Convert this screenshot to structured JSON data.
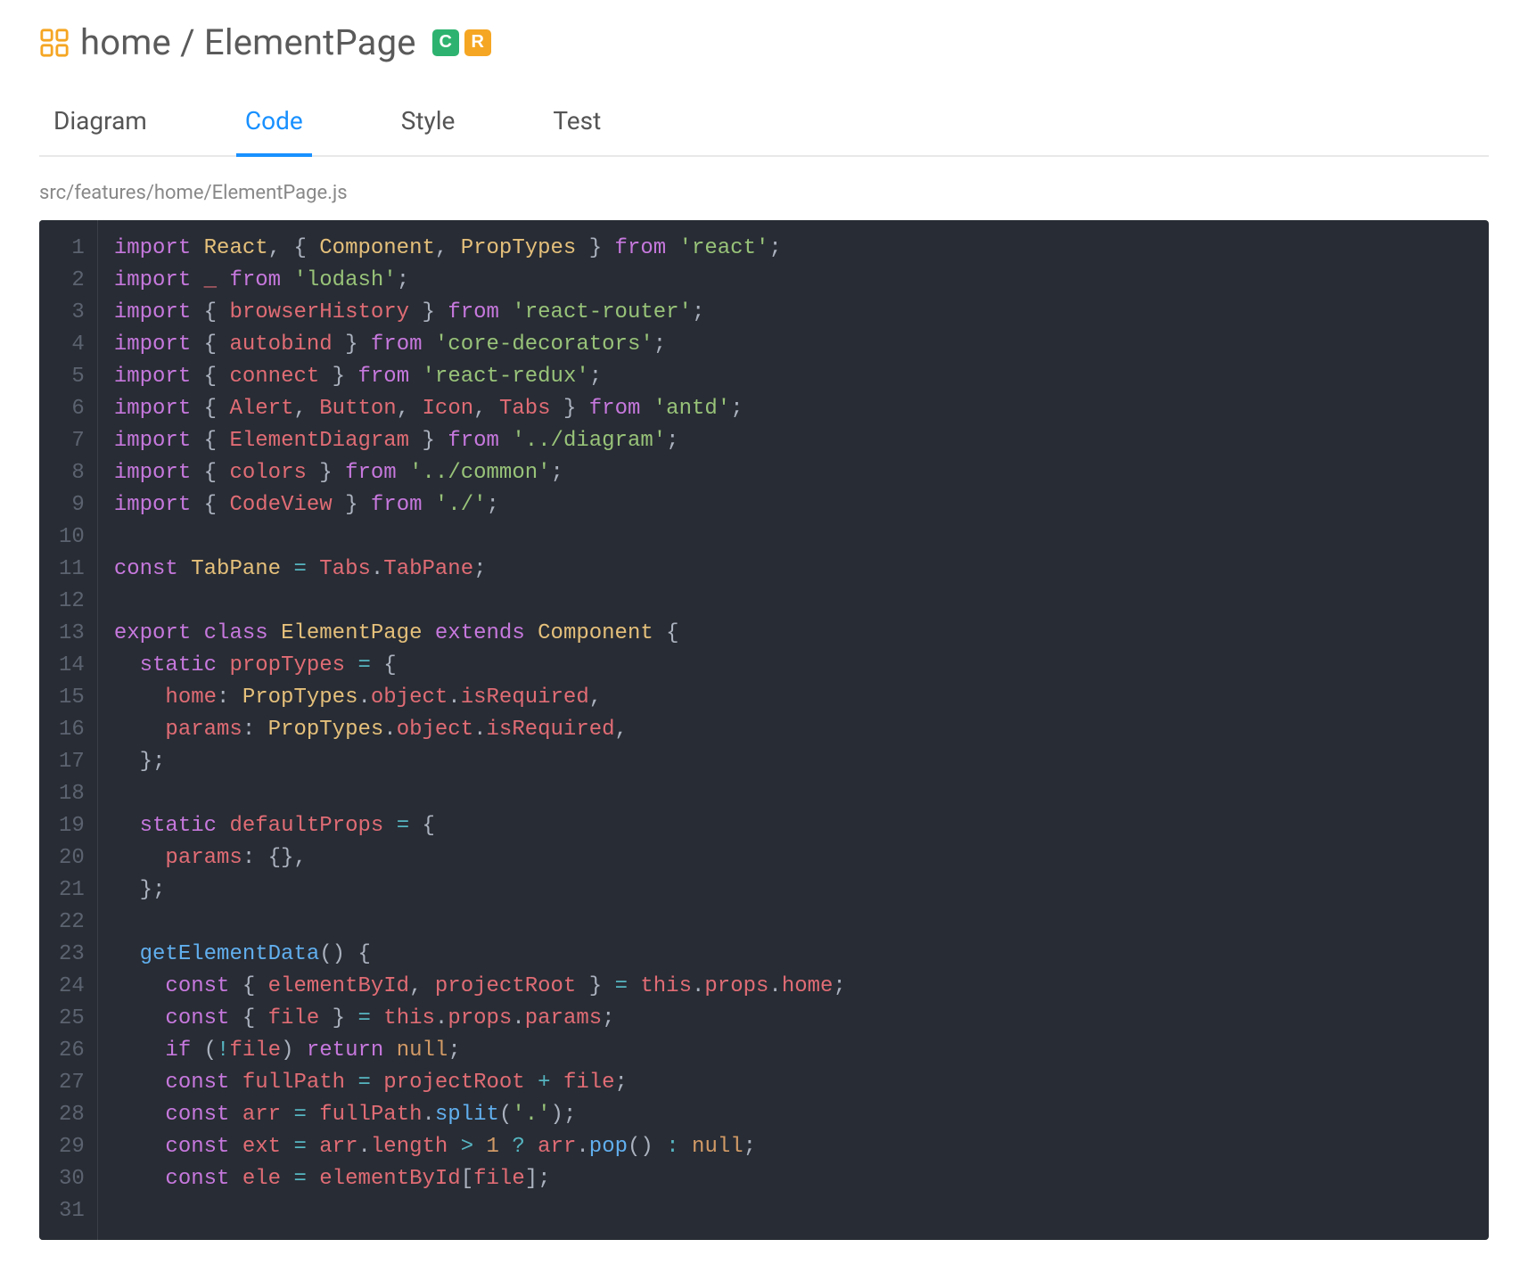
{
  "breadcrumb": {
    "parent": "home",
    "separator": "/",
    "current": "ElementPage"
  },
  "badges": {
    "component": "C",
    "route": "R"
  },
  "tabs": [
    {
      "id": "diagram",
      "label": "Diagram",
      "active": false
    },
    {
      "id": "code",
      "label": "Code",
      "active": true
    },
    {
      "id": "style",
      "label": "Style",
      "active": false
    },
    {
      "id": "test",
      "label": "Test",
      "active": false
    }
  ],
  "file_path": "src/features/home/ElementPage.js",
  "code": {
    "lines": [
      {
        "n": 1,
        "tokens": [
          [
            "kw",
            "import"
          ],
          [
            "punct",
            " "
          ],
          [
            "def",
            "React"
          ],
          [
            "punct",
            ", { "
          ],
          [
            "def",
            "Component"
          ],
          [
            "punct",
            ", "
          ],
          [
            "def",
            "PropTypes"
          ],
          [
            "punct",
            " } "
          ],
          [
            "kw",
            "from"
          ],
          [
            "punct",
            " "
          ],
          [
            "str",
            "'react'"
          ],
          [
            "punct",
            ";"
          ]
        ]
      },
      {
        "n": 2,
        "tokens": [
          [
            "kw",
            "import"
          ],
          [
            "punct",
            " "
          ],
          [
            "var",
            "_"
          ],
          [
            "punct",
            " "
          ],
          [
            "kw",
            "from"
          ],
          [
            "punct",
            " "
          ],
          [
            "str",
            "'lodash'"
          ],
          [
            "punct",
            ";"
          ]
        ]
      },
      {
        "n": 3,
        "tokens": [
          [
            "kw",
            "import"
          ],
          [
            "punct",
            " { "
          ],
          [
            "var",
            "browserHistory"
          ],
          [
            "punct",
            " } "
          ],
          [
            "kw",
            "from"
          ],
          [
            "punct",
            " "
          ],
          [
            "str",
            "'react-router'"
          ],
          [
            "punct",
            ";"
          ]
        ]
      },
      {
        "n": 4,
        "tokens": [
          [
            "kw",
            "import"
          ],
          [
            "punct",
            " { "
          ],
          [
            "var",
            "autobind"
          ],
          [
            "punct",
            " } "
          ],
          [
            "kw",
            "from"
          ],
          [
            "punct",
            " "
          ],
          [
            "str",
            "'core-decorators'"
          ],
          [
            "punct",
            ";"
          ]
        ]
      },
      {
        "n": 5,
        "tokens": [
          [
            "kw",
            "import"
          ],
          [
            "punct",
            " { "
          ],
          [
            "var",
            "connect"
          ],
          [
            "punct",
            " } "
          ],
          [
            "kw",
            "from"
          ],
          [
            "punct",
            " "
          ],
          [
            "str",
            "'react-redux'"
          ],
          [
            "punct",
            ";"
          ]
        ]
      },
      {
        "n": 6,
        "tokens": [
          [
            "kw",
            "import"
          ],
          [
            "punct",
            " { "
          ],
          [
            "var",
            "Alert"
          ],
          [
            "punct",
            ", "
          ],
          [
            "var",
            "Button"
          ],
          [
            "punct",
            ", "
          ],
          [
            "var",
            "Icon"
          ],
          [
            "punct",
            ", "
          ],
          [
            "var",
            "Tabs"
          ],
          [
            "punct",
            " } "
          ],
          [
            "kw",
            "from"
          ],
          [
            "punct",
            " "
          ],
          [
            "str",
            "'antd'"
          ],
          [
            "punct",
            ";"
          ]
        ]
      },
      {
        "n": 7,
        "tokens": [
          [
            "kw",
            "import"
          ],
          [
            "punct",
            " { "
          ],
          [
            "var",
            "ElementDiagram"
          ],
          [
            "punct",
            " } "
          ],
          [
            "kw",
            "from"
          ],
          [
            "punct",
            " "
          ],
          [
            "str",
            "'../diagram'"
          ],
          [
            "punct",
            ";"
          ]
        ]
      },
      {
        "n": 8,
        "tokens": [
          [
            "kw",
            "import"
          ],
          [
            "punct",
            " { "
          ],
          [
            "var",
            "colors"
          ],
          [
            "punct",
            " } "
          ],
          [
            "kw",
            "from"
          ],
          [
            "punct",
            " "
          ],
          [
            "str",
            "'../common'"
          ],
          [
            "punct",
            ";"
          ]
        ]
      },
      {
        "n": 9,
        "tokens": [
          [
            "kw",
            "import"
          ],
          [
            "punct",
            " { "
          ],
          [
            "var",
            "CodeView"
          ],
          [
            "punct",
            " } "
          ],
          [
            "kw",
            "from"
          ],
          [
            "punct",
            " "
          ],
          [
            "str",
            "'./'"
          ],
          [
            "punct",
            ";"
          ]
        ]
      },
      {
        "n": 10,
        "tokens": [
          [
            "punct",
            ""
          ]
        ]
      },
      {
        "n": 11,
        "tokens": [
          [
            "kw",
            "const"
          ],
          [
            "punct",
            " "
          ],
          [
            "def",
            "TabPane"
          ],
          [
            "punct",
            " "
          ],
          [
            "op",
            "="
          ],
          [
            "punct",
            " "
          ],
          [
            "var",
            "Tabs"
          ],
          [
            "punct",
            "."
          ],
          [
            "var",
            "TabPane"
          ],
          [
            "punct",
            ";"
          ]
        ]
      },
      {
        "n": 12,
        "tokens": [
          [
            "punct",
            ""
          ]
        ]
      },
      {
        "n": 13,
        "tokens": [
          [
            "kw",
            "export"
          ],
          [
            "punct",
            " "
          ],
          [
            "kw",
            "class"
          ],
          [
            "punct",
            " "
          ],
          [
            "def",
            "ElementPage"
          ],
          [
            "punct",
            " "
          ],
          [
            "kw",
            "extends"
          ],
          [
            "punct",
            " "
          ],
          [
            "def",
            "Component"
          ],
          [
            "punct",
            " {"
          ]
        ]
      },
      {
        "n": 14,
        "tokens": [
          [
            "punct",
            "  "
          ],
          [
            "kw",
            "static"
          ],
          [
            "punct",
            " "
          ],
          [
            "var",
            "propTypes"
          ],
          [
            "punct",
            " "
          ],
          [
            "op",
            "="
          ],
          [
            "punct",
            " {"
          ]
        ]
      },
      {
        "n": 15,
        "tokens": [
          [
            "punct",
            "    "
          ],
          [
            "var",
            "home"
          ],
          [
            "punct",
            ": "
          ],
          [
            "def",
            "PropTypes"
          ],
          [
            "punct",
            "."
          ],
          [
            "var",
            "object"
          ],
          [
            "punct",
            "."
          ],
          [
            "var",
            "isRequired"
          ],
          [
            "punct",
            ","
          ]
        ]
      },
      {
        "n": 16,
        "tokens": [
          [
            "punct",
            "    "
          ],
          [
            "var",
            "params"
          ],
          [
            "punct",
            ": "
          ],
          [
            "def",
            "PropTypes"
          ],
          [
            "punct",
            "."
          ],
          [
            "var",
            "object"
          ],
          [
            "punct",
            "."
          ],
          [
            "var",
            "isRequired"
          ],
          [
            "punct",
            ","
          ]
        ]
      },
      {
        "n": 17,
        "tokens": [
          [
            "punct",
            "  };"
          ]
        ]
      },
      {
        "n": 18,
        "tokens": [
          [
            "punct",
            ""
          ]
        ]
      },
      {
        "n": 19,
        "tokens": [
          [
            "punct",
            "  "
          ],
          [
            "kw",
            "static"
          ],
          [
            "punct",
            " "
          ],
          [
            "var",
            "defaultProps"
          ],
          [
            "punct",
            " "
          ],
          [
            "op",
            "="
          ],
          [
            "punct",
            " {"
          ]
        ]
      },
      {
        "n": 20,
        "tokens": [
          [
            "punct",
            "    "
          ],
          [
            "var",
            "params"
          ],
          [
            "punct",
            ": {},"
          ]
        ]
      },
      {
        "n": 21,
        "tokens": [
          [
            "punct",
            "  };"
          ]
        ]
      },
      {
        "n": 22,
        "tokens": [
          [
            "punct",
            ""
          ]
        ]
      },
      {
        "n": 23,
        "tokens": [
          [
            "punct",
            "  "
          ],
          [
            "fn",
            "getElementData"
          ],
          [
            "punct",
            "() {"
          ]
        ]
      },
      {
        "n": 24,
        "tokens": [
          [
            "punct",
            "    "
          ],
          [
            "kw",
            "const"
          ],
          [
            "punct",
            " { "
          ],
          [
            "var",
            "elementById"
          ],
          [
            "punct",
            ", "
          ],
          [
            "var",
            "projectRoot"
          ],
          [
            "punct",
            " } "
          ],
          [
            "op",
            "="
          ],
          [
            "punct",
            " "
          ],
          [
            "this",
            "this"
          ],
          [
            "punct",
            "."
          ],
          [
            "var",
            "props"
          ],
          [
            "punct",
            "."
          ],
          [
            "var",
            "home"
          ],
          [
            "punct",
            ";"
          ]
        ]
      },
      {
        "n": 25,
        "tokens": [
          [
            "punct",
            "    "
          ],
          [
            "kw",
            "const"
          ],
          [
            "punct",
            " { "
          ],
          [
            "var",
            "file"
          ],
          [
            "punct",
            " } "
          ],
          [
            "op",
            "="
          ],
          [
            "punct",
            " "
          ],
          [
            "this",
            "this"
          ],
          [
            "punct",
            "."
          ],
          [
            "var",
            "props"
          ],
          [
            "punct",
            "."
          ],
          [
            "var",
            "params"
          ],
          [
            "punct",
            ";"
          ]
        ]
      },
      {
        "n": 26,
        "tokens": [
          [
            "punct",
            "    "
          ],
          [
            "kw",
            "if"
          ],
          [
            "punct",
            " ("
          ],
          [
            "op",
            "!"
          ],
          [
            "var",
            "file"
          ],
          [
            "punct",
            ") "
          ],
          [
            "kw",
            "return"
          ],
          [
            "punct",
            " "
          ],
          [
            "null",
            "null"
          ],
          [
            "punct",
            ";"
          ]
        ]
      },
      {
        "n": 27,
        "tokens": [
          [
            "punct",
            "    "
          ],
          [
            "kw",
            "const"
          ],
          [
            "punct",
            " "
          ],
          [
            "var",
            "fullPath"
          ],
          [
            "punct",
            " "
          ],
          [
            "op",
            "="
          ],
          [
            "punct",
            " "
          ],
          [
            "var",
            "projectRoot"
          ],
          [
            "punct",
            " "
          ],
          [
            "op",
            "+"
          ],
          [
            "punct",
            " "
          ],
          [
            "var",
            "file"
          ],
          [
            "punct",
            ";"
          ]
        ]
      },
      {
        "n": 28,
        "tokens": [
          [
            "punct",
            "    "
          ],
          [
            "kw",
            "const"
          ],
          [
            "punct",
            " "
          ],
          [
            "var",
            "arr"
          ],
          [
            "punct",
            " "
          ],
          [
            "op",
            "="
          ],
          [
            "punct",
            " "
          ],
          [
            "var",
            "fullPath"
          ],
          [
            "punct",
            "."
          ],
          [
            "fn",
            "split"
          ],
          [
            "punct",
            "("
          ],
          [
            "str",
            "'.'"
          ],
          [
            "punct",
            ");"
          ]
        ]
      },
      {
        "n": 29,
        "tokens": [
          [
            "punct",
            "    "
          ],
          [
            "kw",
            "const"
          ],
          [
            "punct",
            " "
          ],
          [
            "var",
            "ext"
          ],
          [
            "punct",
            " "
          ],
          [
            "op",
            "="
          ],
          [
            "punct",
            " "
          ],
          [
            "var",
            "arr"
          ],
          [
            "punct",
            "."
          ],
          [
            "var",
            "length"
          ],
          [
            "punct",
            " "
          ],
          [
            "op",
            ">"
          ],
          [
            "punct",
            " "
          ],
          [
            "num",
            "1"
          ],
          [
            "punct",
            " "
          ],
          [
            "op",
            "?"
          ],
          [
            "punct",
            " "
          ],
          [
            "var",
            "arr"
          ],
          [
            "punct",
            "."
          ],
          [
            "fn",
            "pop"
          ],
          [
            "punct",
            "() "
          ],
          [
            "op",
            ":"
          ],
          [
            "punct",
            " "
          ],
          [
            "null",
            "null"
          ],
          [
            "punct",
            ";"
          ]
        ]
      },
      {
        "n": 30,
        "tokens": [
          [
            "punct",
            "    "
          ],
          [
            "kw",
            "const"
          ],
          [
            "punct",
            " "
          ],
          [
            "var",
            "ele"
          ],
          [
            "punct",
            " "
          ],
          [
            "op",
            "="
          ],
          [
            "punct",
            " "
          ],
          [
            "var",
            "elementById"
          ],
          [
            "punct",
            "["
          ],
          [
            "var",
            "file"
          ],
          [
            "punct",
            "];"
          ]
        ]
      },
      {
        "n": 31,
        "tokens": [
          [
            "punct",
            ""
          ]
        ]
      }
    ]
  }
}
